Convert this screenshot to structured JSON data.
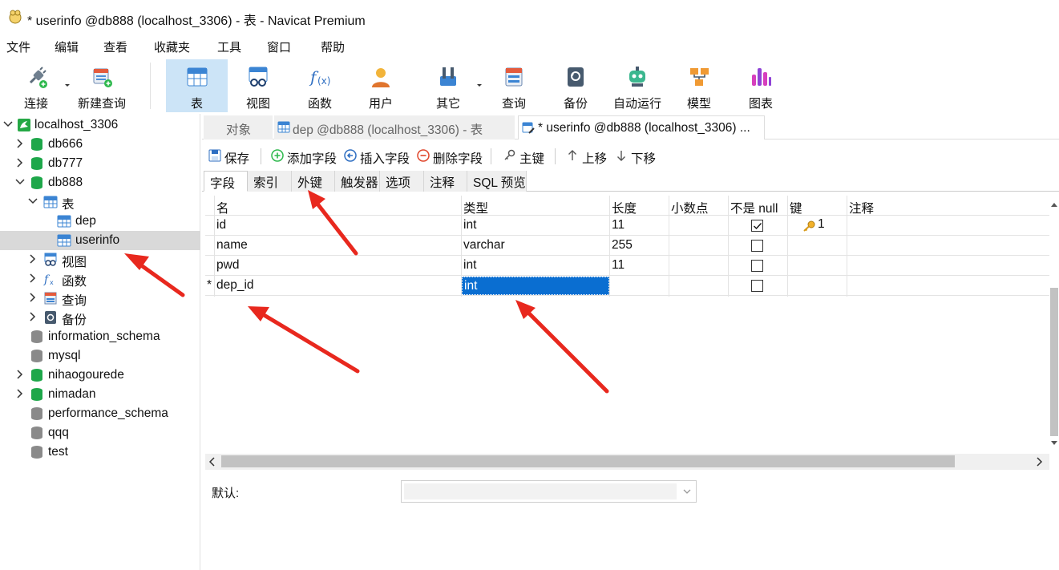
{
  "window": {
    "title": "* userinfo @db888 (localhost_3306) - 表 - Navicat Premium"
  },
  "menu": [
    "文件",
    "编辑",
    "查看",
    "收藏夹",
    "工具",
    "窗口",
    "帮助"
  ],
  "toolbar": {
    "connect": "连接",
    "new_query": "新建查询",
    "table": "表",
    "view": "视图",
    "function": "函数",
    "user": "用户",
    "other": "其它",
    "query": "查询",
    "backup": "备份",
    "automation": "自动运行",
    "model": "模型",
    "chart": "图表",
    "active": "表"
  },
  "sidebar": {
    "connection": "localhost_3306",
    "databases": [
      "db666",
      "db777",
      "db888"
    ],
    "db888_children": {
      "tables_label": "表",
      "tables": [
        "dep",
        "userinfo"
      ],
      "view": "视图",
      "function": "函数",
      "query": "查询",
      "backup": "备份"
    },
    "other_databases": [
      "information_schema",
      "mysql",
      "nihaogourede",
      "nimadan",
      "performance_schema",
      "qqq",
      "test"
    ],
    "selected": "userinfo"
  },
  "tabs": {
    "objects": "对象",
    "dep_tab": "dep @db888 (localhost_3306) - 表",
    "userinfo_tab": "* userinfo @db888 (localhost_3306) ..."
  },
  "editor_toolbar": {
    "save": "保存",
    "add_field": "添加字段",
    "insert_field": "插入字段",
    "delete_field": "删除字段",
    "primary_key": "主键",
    "move_up": "上移",
    "move_down": "下移"
  },
  "subtabs": [
    "字段",
    "索引",
    "外键",
    "触发器",
    "选项",
    "注释",
    "SQL 预览"
  ],
  "grid": {
    "headers": {
      "name": "名",
      "type": "类型",
      "length": "长度",
      "decimals": "小数点",
      "not_null": "不是 null",
      "key": "键",
      "comment": "注释"
    },
    "rows": [
      {
        "marker": "",
        "name": "id",
        "type": "int",
        "length": "11",
        "decimals": "",
        "not_null": true,
        "key": "1",
        "comment": ""
      },
      {
        "marker": "",
        "name": "name",
        "type": "varchar",
        "length": "255",
        "decimals": "",
        "not_null": false,
        "key": "",
        "comment": ""
      },
      {
        "marker": "",
        "name": "pwd",
        "type": "int",
        "length": "11",
        "decimals": "",
        "not_null": false,
        "key": "",
        "comment": ""
      },
      {
        "marker": "*",
        "name": "dep_id",
        "type": "int",
        "length": "",
        "decimals": "",
        "not_null": false,
        "key": "",
        "comment": ""
      }
    ]
  },
  "properties": {
    "default_label": "默认:",
    "default_value": ""
  },
  "colors": {
    "accent": "#0a6ed1",
    "selection": "#cce4f7",
    "db_green": "#1ea74a",
    "annotation": "#e8281e"
  }
}
